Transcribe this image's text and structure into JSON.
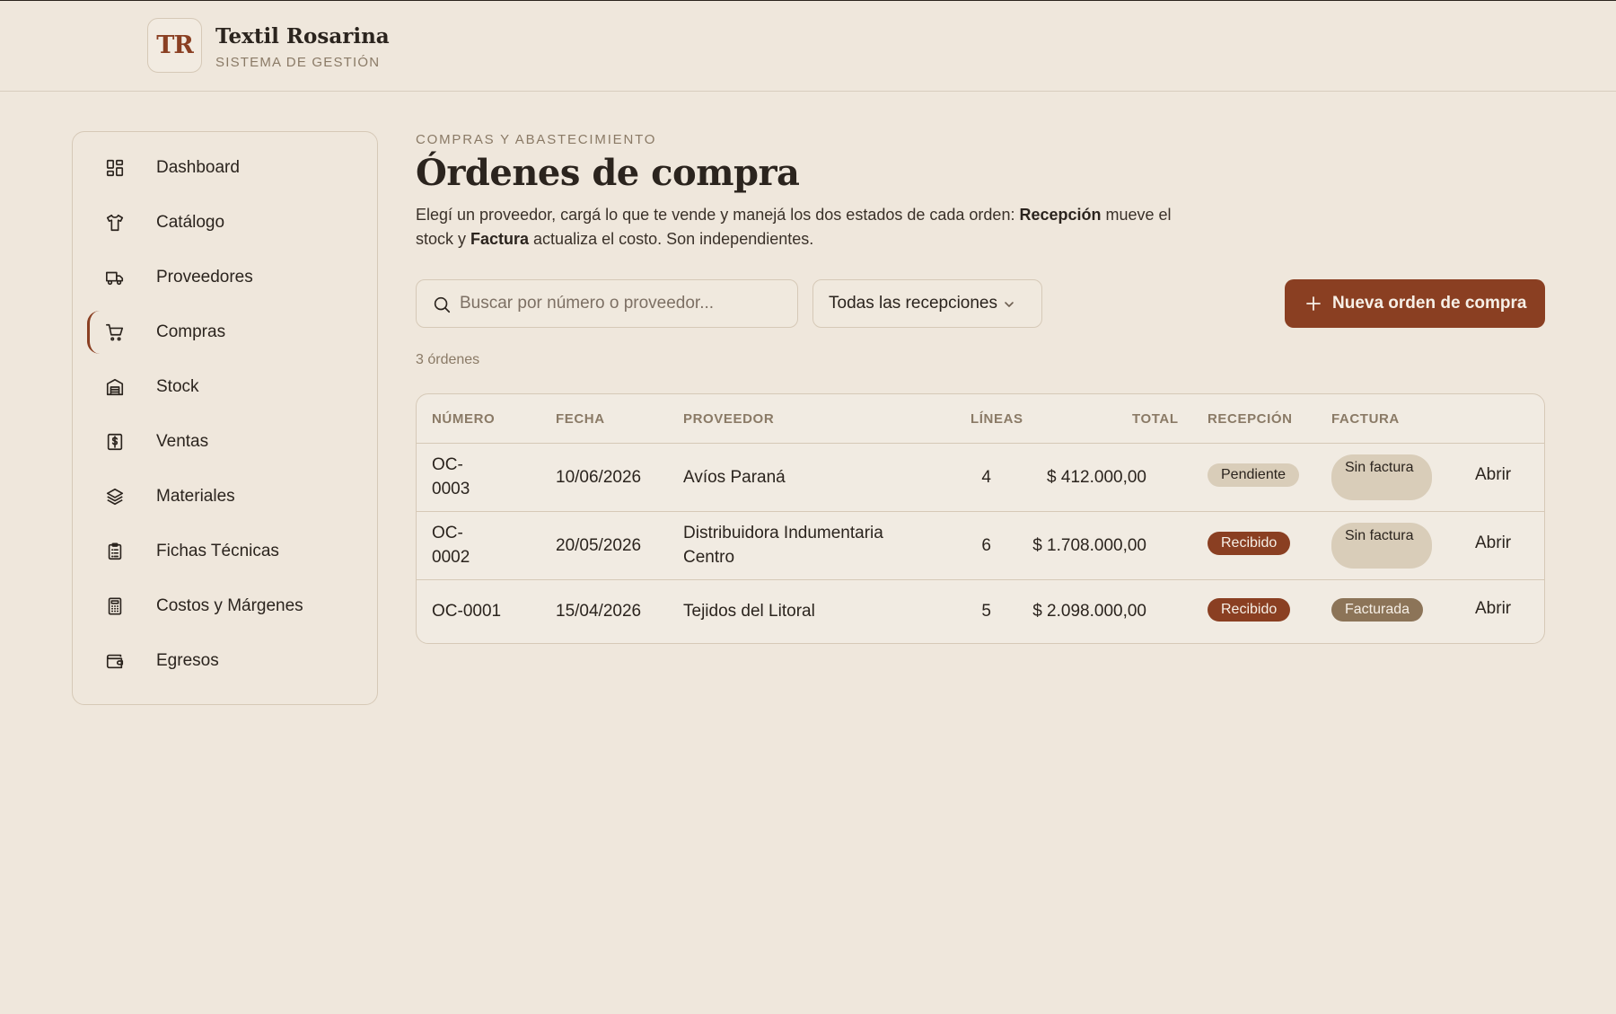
{
  "brand": {
    "logo": "TR",
    "name": "Textil Rosarina",
    "subtitle": "SISTEMA DE GESTIÓN"
  },
  "sidebar": {
    "items": [
      {
        "label": "Dashboard",
        "icon": "dashboard-icon"
      },
      {
        "label": "Catálogo",
        "icon": "shirt-icon"
      },
      {
        "label": "Proveedores",
        "icon": "truck-icon"
      },
      {
        "label": "Compras",
        "icon": "cart-icon",
        "active": true
      },
      {
        "label": "Stock",
        "icon": "warehouse-icon"
      },
      {
        "label": "Ventas",
        "icon": "receipt-dollar-icon"
      },
      {
        "label": "Materiales",
        "icon": "layers-icon"
      },
      {
        "label": "Fichas Técnicas",
        "icon": "clipboard-icon"
      },
      {
        "label": "Costos y Márgenes",
        "icon": "calculator-icon"
      },
      {
        "label": "Egresos",
        "icon": "wallet-icon"
      }
    ]
  },
  "page": {
    "kicker": "COMPRAS Y ABASTECIMIENTO",
    "title": "Órdenes de compra",
    "desc_1": "Elegí un proveedor, cargá lo que te vende y manejá los dos estados de cada orden: ",
    "desc_b1": "Recepción",
    "desc_2": " mueve el stock y ",
    "desc_b2": "Factura",
    "desc_3": " actualiza el costo. Son independientes."
  },
  "toolbar": {
    "search_placeholder": "Buscar por número o proveedor...",
    "filter_value": "Todas las recepciones",
    "new_button": "Nueva orden de compra"
  },
  "count_label": "3 órdenes",
  "table": {
    "headers": {
      "numero": "NÚMERO",
      "fecha": "FECHA",
      "proveedor": "PROVEEDOR",
      "lineas": "LÍNEAS",
      "total": "TOTAL",
      "recepcion": "RECEPCIÓN",
      "factura": "FACTURA"
    },
    "rows": [
      {
        "numero": "OC-\n0003",
        "fecha": "10/06/2026",
        "proveedor": "Avíos Paraná",
        "lineas": "4",
        "total": "$ 412.000,00",
        "recepcion": "Pendiente",
        "factura": "Sin factura",
        "action": "Abrir"
      },
      {
        "numero": "OC-\n0002",
        "fecha": "20/05/2026",
        "proveedor": "Distribuidora Indumentaria Centro",
        "lineas": "6",
        "total": "$ 1.708.000,00",
        "recepcion": "Recibido",
        "factura": "Sin factura",
        "action": "Abrir"
      },
      {
        "numero": "OC-0001",
        "fecha": "15/04/2026",
        "proveedor": "Tejidos del Litoral",
        "lineas": "5",
        "total": "$ 2.098.000,00",
        "recepcion": "Recibido",
        "factura": "Facturada",
        "action": "Abrir"
      }
    ]
  },
  "colors": {
    "accent": "#8A3F22",
    "background": "#EFE7DC",
    "muted": "#8A7A66",
    "border": "#D6C9B7"
  }
}
